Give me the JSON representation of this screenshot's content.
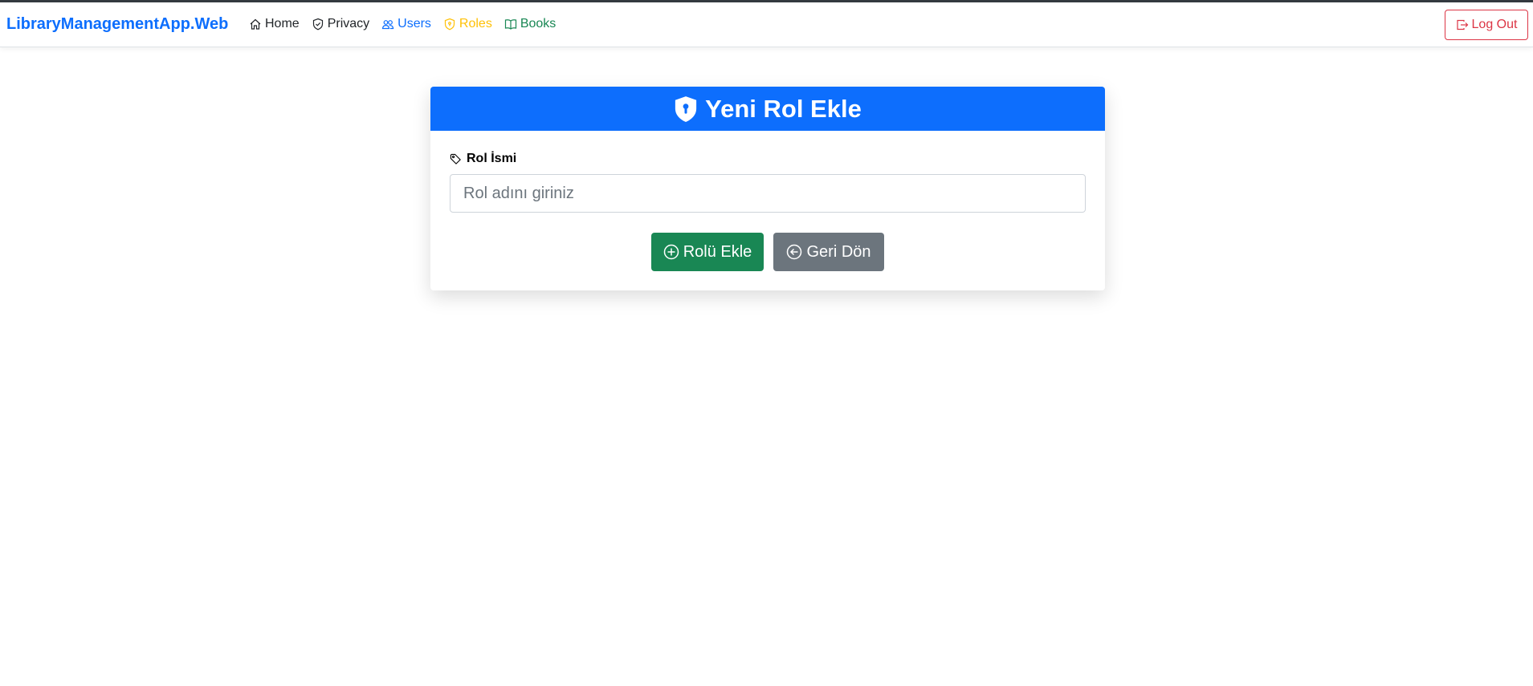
{
  "navbar": {
    "brand": "LibraryManagementApp.Web",
    "links": [
      {
        "label": "Home",
        "icon": "house-icon",
        "color": "#212529"
      },
      {
        "label": "Privacy",
        "icon": "shield-icon",
        "color": "#212529"
      },
      {
        "label": "Users",
        "icon": "people-icon",
        "color": "#0d6efd"
      },
      {
        "label": "Roles",
        "icon": "shield-lock-icon",
        "color": "#ffc107"
      },
      {
        "label": "Books",
        "icon": "book-icon",
        "color": "#198754"
      }
    ],
    "logout_label": "Log Out"
  },
  "card": {
    "title": "Yeni Rol Ekle",
    "field_label": "Rol İsmi",
    "input_placeholder": "Rol adını giriniz",
    "input_value": "",
    "submit_label": "Rolü Ekle",
    "back_label": "Geri Dön"
  },
  "colors": {
    "primary": "#0d6efd",
    "success": "#198754",
    "secondary": "#6c757d",
    "danger": "#dc3545",
    "warning": "#ffc107"
  }
}
